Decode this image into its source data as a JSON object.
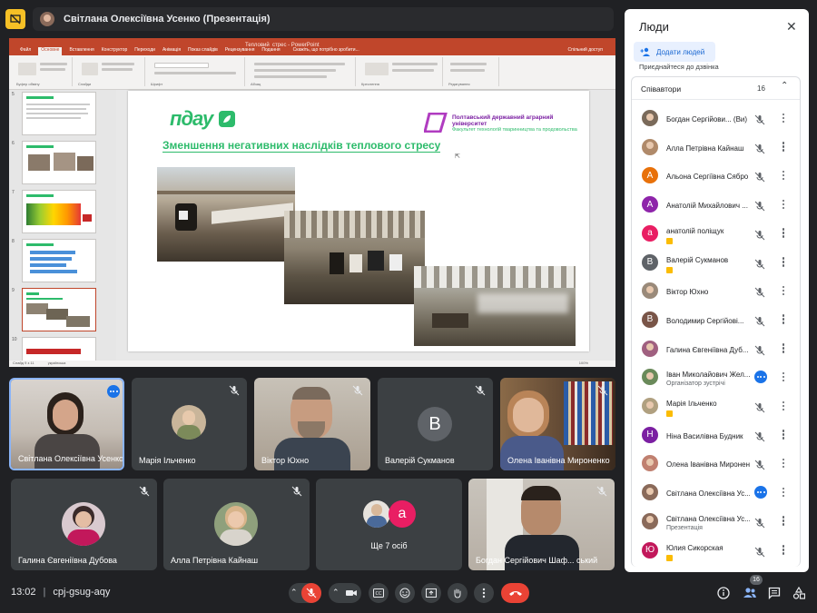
{
  "presenter_bar": {
    "name": "Світлана Олексіївна Усенко (Презентація)"
  },
  "presentation": {
    "window_title": "Тепловий_стрес - PowerPoint",
    "menu_tabs": [
      "Файл",
      "Основне",
      "Вставлення",
      "Конструктор",
      "Переходи",
      "Анімація",
      "Показ слайдів",
      "Рецензування",
      "Подання"
    ],
    "search_hint": "Скажіть, що потрібно зробити...",
    "share_label": "Спільний доступ",
    "ribbon_labels": [
      "Буфер обміну",
      "Слайди",
      "Шрифт",
      "Абзац",
      "Креслення",
      "Редагування"
    ],
    "slide_numbers": [
      "5",
      "6",
      "7",
      "8",
      "9",
      "10"
    ],
    "status_left": "Слайд 9 з 11",
    "status_lang": "українська",
    "zoom": "100%",
    "slide": {
      "logo_text": "пдау",
      "university": "Полтавський державний аграрний університет",
      "faculty": "Факультет технологій тваринництва та продовольства",
      "title": "Зменшення негативних  наслідків теплового стресу"
    }
  },
  "tiles_row1": [
    {
      "name": "Світлана Олексіївна Усенко",
      "type": "video"
    },
    {
      "name": "Марія Ільченко",
      "type": "avatar"
    },
    {
      "name": "Віктор Юхно",
      "type": "video"
    },
    {
      "name": "Валерій Сукманов",
      "type": "letter",
      "letter": "В",
      "color": "#5f6368"
    },
    {
      "name": "Олена Іванівна Мироненко",
      "type": "video"
    }
  ],
  "tiles_row2": [
    {
      "name": "Галина Євгеніївна Дубова",
      "type": "avatar"
    },
    {
      "name": "Алла Петрівна Кайнаш",
      "type": "avatar"
    },
    {
      "name": "Ще 7 осіб",
      "type": "group",
      "letter": "а"
    },
    {
      "name": "Богдан Сергійович Шаф... ський",
      "type": "video"
    }
  ],
  "bottom_bar": {
    "time": "13:02",
    "meeting_code": "cpj-gsug-aqy",
    "participants_badge": "16"
  },
  "people_panel": {
    "title": "Люди",
    "add_people": "Додати людей",
    "join_hint": "Приєднайтеся до дзвінка",
    "section_label": "Співавтори",
    "section_count": "16",
    "people": [
      {
        "name": "Богдан Сергійови...",
        "suffix": "(Ви)",
        "color": "#7a6a5a",
        "letter": "",
        "sub": ""
      },
      {
        "name": "Алла Петрівна Кайнаш",
        "color": "#b08a6a",
        "letter": "",
        "sub": ""
      },
      {
        "name": "Альона Сергіївна Сябро",
        "color": "#e8710a",
        "letter": "А",
        "sub": ""
      },
      {
        "name": "Анатолій Михайлович ...",
        "color": "#8e24aa",
        "letter": "А",
        "sub": ""
      },
      {
        "name": "анатолій поліщук",
        "color": "#e91e63",
        "letter": "а",
        "sub": "tag"
      },
      {
        "name": "Валерій Сукманов",
        "color": "#5f6368",
        "letter": "В",
        "sub": "tag"
      },
      {
        "name": "Віктор Юхно",
        "color": "#9a8a7a",
        "letter": "",
        "sub": ""
      },
      {
        "name": "Володимир Сергійові...",
        "color": "#795548",
        "letter": "В",
        "sub": ""
      },
      {
        "name": "Галина Євгеніївна Дуб...",
        "color": "#a06080",
        "letter": "",
        "sub": ""
      },
      {
        "name": "Іван Миколайович Жел...",
        "color": "#6a8a5a",
        "letter": "",
        "sub": "Організатор зустрічі"
      },
      {
        "name": "Марія Ільченко",
        "color": "#b0a080",
        "letter": "",
        "sub": "tag"
      },
      {
        "name": "Ніна Василівна Будник",
        "color": "#7b1fa2",
        "letter": "Н",
        "sub": ""
      },
      {
        "name": "Олена Іванівна Миронен...",
        "color": "#c08070",
        "letter": "",
        "sub": ""
      },
      {
        "name": "Світлана Олексіївна Ус...",
        "color": "#8a6a5a",
        "letter": "",
        "sub": ""
      },
      {
        "name": "Світлана Олексіївна Ус...",
        "color": "#8a6a5a",
        "letter": "",
        "sub": "Презентація"
      },
      {
        "name": "Юлия Сикорская",
        "color": "#c2185b",
        "letter": "Ю",
        "sub": "tag"
      }
    ]
  }
}
